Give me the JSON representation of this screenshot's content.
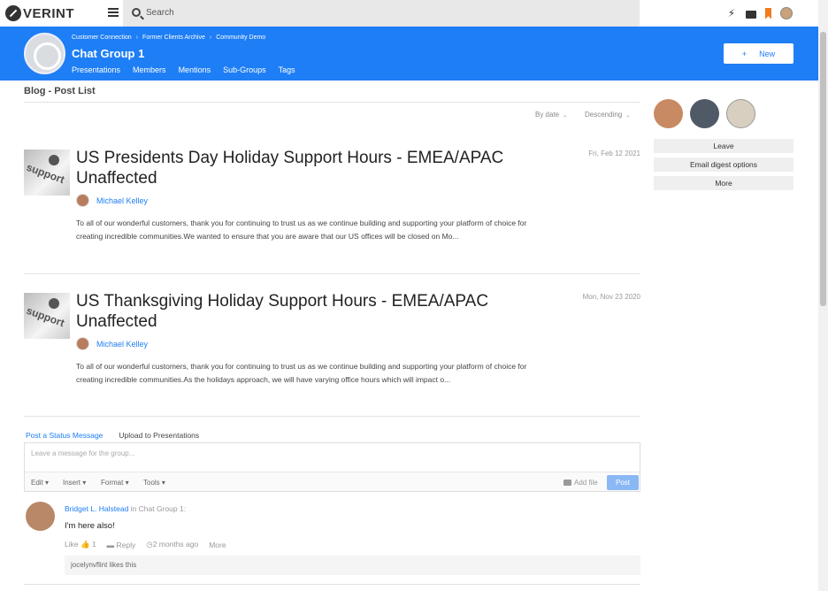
{
  "topbar": {
    "logo_text": "VERINT",
    "search_placeholder": "Search"
  },
  "banner": {
    "breadcrumbs": [
      "Customer Connection",
      "Former Clients Archive",
      "Community Demo"
    ],
    "title": "Chat Group 1",
    "nav": [
      "Presentations",
      "Members",
      "Mentions",
      "Sub-Groups",
      "Tags"
    ],
    "new_label": "New",
    "new_icon": "+"
  },
  "page": {
    "title": "Blog - Post List",
    "sort_by": "By date",
    "sort_order": "Descending"
  },
  "posts": [
    {
      "thumb_text": "support",
      "title": "US Presidents Day Holiday Support Hours - EMEA/APAC Unaffected",
      "date": "Fri, Feb 12 2021",
      "author": "Michael Kelley",
      "excerpt": "To all of our wonderful customers, thank you for continuing to trust us as we continue building and supporting your platform of choice for creating incredible communities.We wanted to ensure that you are aware that our US offices will be closed on Mo..."
    },
    {
      "thumb_text": "support",
      "title": "US Thanksgiving Holiday Support Hours - EMEA/APAC Unaffected",
      "date": "Mon, Nov 23 2020",
      "author": "Michael Kelley",
      "excerpt": "To all of our wonderful customers, thank you for continuing to trust us as we continue building and supporting your platform of choice for creating incredible communities.As the holidays approach, we will have varying office hours which will impact o..."
    }
  ],
  "composer": {
    "tabs": [
      "Post a Status Message",
      "Upload to Presentations"
    ],
    "placeholder": "Leave a message for the group...",
    "tools": [
      "Edit",
      "Insert",
      "Format",
      "Tools"
    ],
    "add_file": "Add file",
    "post_label": "Post"
  },
  "status": {
    "author": "Bridget L. Halstead",
    "in_text": "in",
    "group": "Chat Group 1:",
    "text": "I'm here also!",
    "like_label": "Like",
    "like_count": "1",
    "reply_label": "Reply",
    "time": "2 months ago",
    "more_label": "More",
    "likes_text": "jocelynvflint likes this"
  },
  "sidebar": {
    "buttons": [
      "Leave",
      "Email digest options",
      "More"
    ]
  },
  "colors": {
    "accent": "#1e7ef5",
    "brand_orange": "#f07c1e"
  }
}
